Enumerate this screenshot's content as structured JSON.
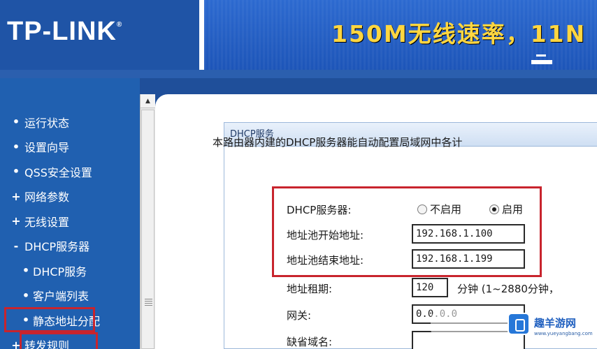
{
  "header": {
    "logo": "TP-LINK",
    "banner_text": "150M无线速率，11N"
  },
  "sidebar": {
    "items": [
      {
        "marker": "•",
        "label": "运行状态"
      },
      {
        "marker": "•",
        "label": "设置向导"
      },
      {
        "marker": "•",
        "label": "QSS安全设置"
      },
      {
        "marker": "+",
        "label": "网络参数"
      },
      {
        "marker": "+",
        "label": "无线设置"
      },
      {
        "marker": "-",
        "label": "DHCP服务器"
      },
      {
        "marker": "•",
        "label": "DHCP服务"
      },
      {
        "marker": "•",
        "label": "客户端列表"
      },
      {
        "marker": "•",
        "label": "静态地址分配"
      },
      {
        "marker": "+",
        "label": "转发规则"
      }
    ]
  },
  "panel": {
    "title": "DHCP服务",
    "description": "本路由器内建的DHCP服务器能自动配置局域网中各计"
  },
  "form": {
    "dhcp_label": "DHCP服务器:",
    "disable_label": "不启用",
    "enable_label": "启用",
    "pool_start_label": "地址池开始地址:",
    "pool_start_value": "192.168.1.100",
    "pool_end_label": "地址池结束地址:",
    "pool_end_value": "192.168.1.199",
    "lease_label": "地址租期:",
    "lease_value": "120",
    "lease_unit": "分钟  (1~2880分钟，",
    "gateway_label": "网关:",
    "gateway_value": "0.0.0.0",
    "domain_label": "缺省域名:",
    "domain_value": ""
  },
  "watermark": {
    "text": "趣羊游网",
    "url": "www.yueyangbang.com"
  }
}
